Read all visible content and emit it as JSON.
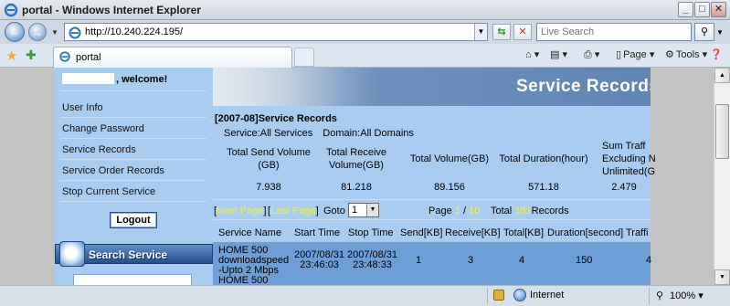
{
  "window": {
    "title": "portal - Windows Internet Explorer",
    "min": "_",
    "max": "□",
    "close": "✕"
  },
  "browser": {
    "url": "http://10.240.224.195/",
    "search_placeholder": "Live Search",
    "tab_label": "portal",
    "commands": {
      "page": "Page",
      "tools": "Tools"
    },
    "status_zone": "Internet",
    "zoom": "100%"
  },
  "sidebar": {
    "welcome": ", welcome!",
    "items": [
      {
        "label": "User Info"
      },
      {
        "label": "Change Password"
      },
      {
        "label": "Service Records"
      },
      {
        "label": "Service Order Records"
      },
      {
        "label": "Stop Current Service"
      }
    ],
    "logout": "Logout",
    "search_service": "Search Service"
  },
  "content": {
    "banner_title": "Service Records",
    "section_title": "[2007-08]Service Records",
    "filter_service": "Service:All Services",
    "filter_domain": "Domain:All Domains",
    "summary": [
      {
        "label_1": "Total Send Volume",
        "label_2": "(GB)",
        "value": "7.938"
      },
      {
        "label_1": "Total Receive",
        "label_2": "Volume(GB)",
        "value": "81.218"
      },
      {
        "label_1": "Total Volume(GB)",
        "label_2": "",
        "value": "89.156"
      },
      {
        "label_1": "Total Duration(hour)",
        "label_2": "",
        "value": "571.18"
      },
      {
        "label_1": "Sum Traff",
        "label_2": "Excluding N",
        "label_3": "Unlimited(G",
        "value": "2.479"
      }
    ],
    "pager": {
      "next": "Next Page",
      "last": "Last Page",
      "goto_label": "Goto Page:",
      "goto_value": "1",
      "page_prefix": "Page",
      "page_current": "1",
      "page_sep": "/",
      "page_total": "10",
      "total_prefix": "Total",
      "total_records": "181",
      "total_suffix": "Records"
    },
    "table": {
      "headers": [
        "Service Name",
        "Start Time",
        "Stop Time",
        "Send[KB]",
        "Receive[KB]",
        "Total[KB]",
        "Duration[second]",
        "Traffi"
      ],
      "rows": [
        {
          "service_1": "HOME 500",
          "service_2": "downloadspeed",
          "service_3": "-Upto 2 Mbps",
          "service_4": "HOME 500",
          "start_1": "2007/08/31",
          "start_2": "23:46:03",
          "stop_1": "2007/08/31",
          "stop_2": "23:48:33",
          "send": "1",
          "receive": "3",
          "total": "4",
          "duration": "150",
          "traffic": "4"
        }
      ]
    }
  }
}
